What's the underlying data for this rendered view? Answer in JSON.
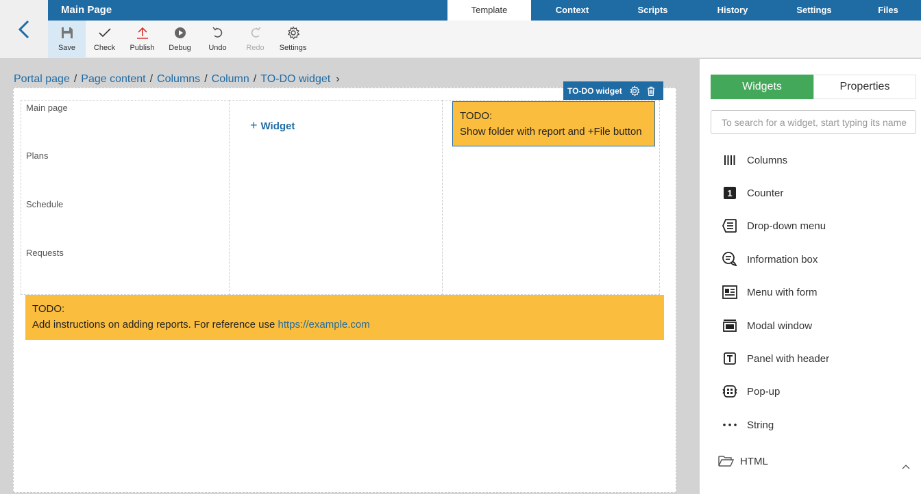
{
  "header": {
    "title": "Main Page",
    "tabs": [
      {
        "label": "Template",
        "active": true
      },
      {
        "label": "Context"
      },
      {
        "label": "Scripts"
      },
      {
        "label": "History"
      },
      {
        "label": "Settings"
      },
      {
        "label": "Files"
      }
    ]
  },
  "toolbar": {
    "save": "Save",
    "check": "Check",
    "publish": "Publish",
    "debug": "Debug",
    "undo": "Undo",
    "redo": "Redo",
    "settings": "Settings"
  },
  "breadcrumb": [
    "Portal page",
    "Page content",
    "Columns",
    "Column",
    "TO-DO widget"
  ],
  "canvas": {
    "menu_links": [
      "Main page",
      "Plans",
      "Schedule",
      "Requests"
    ],
    "add_widget": "Widget",
    "selected_widget_label": "TO-DO widget",
    "todo_top": {
      "line1": "TODO:",
      "line2": "Show folder with report and +File button"
    },
    "todo_bottom": {
      "line1": "TODO:",
      "line2": "Add instructions on adding reports. For reference use ",
      "link": "https://example.com"
    }
  },
  "panel": {
    "tabs": [
      "Widgets",
      "Properties"
    ],
    "search_placeholder": "To search for a widget, start typing its name",
    "widgets": [
      "Columns",
      "Counter",
      "Drop-down menu",
      "Information box",
      "Menu with form",
      "Modal window",
      "Panel with header",
      "Pop-up",
      "String"
    ],
    "group": "HTML",
    "counter_badge": "1"
  },
  "colors": {
    "primary": "#1f6ba4",
    "accent_green": "#43a859",
    "todo_yellow": "#fbbd3e"
  }
}
